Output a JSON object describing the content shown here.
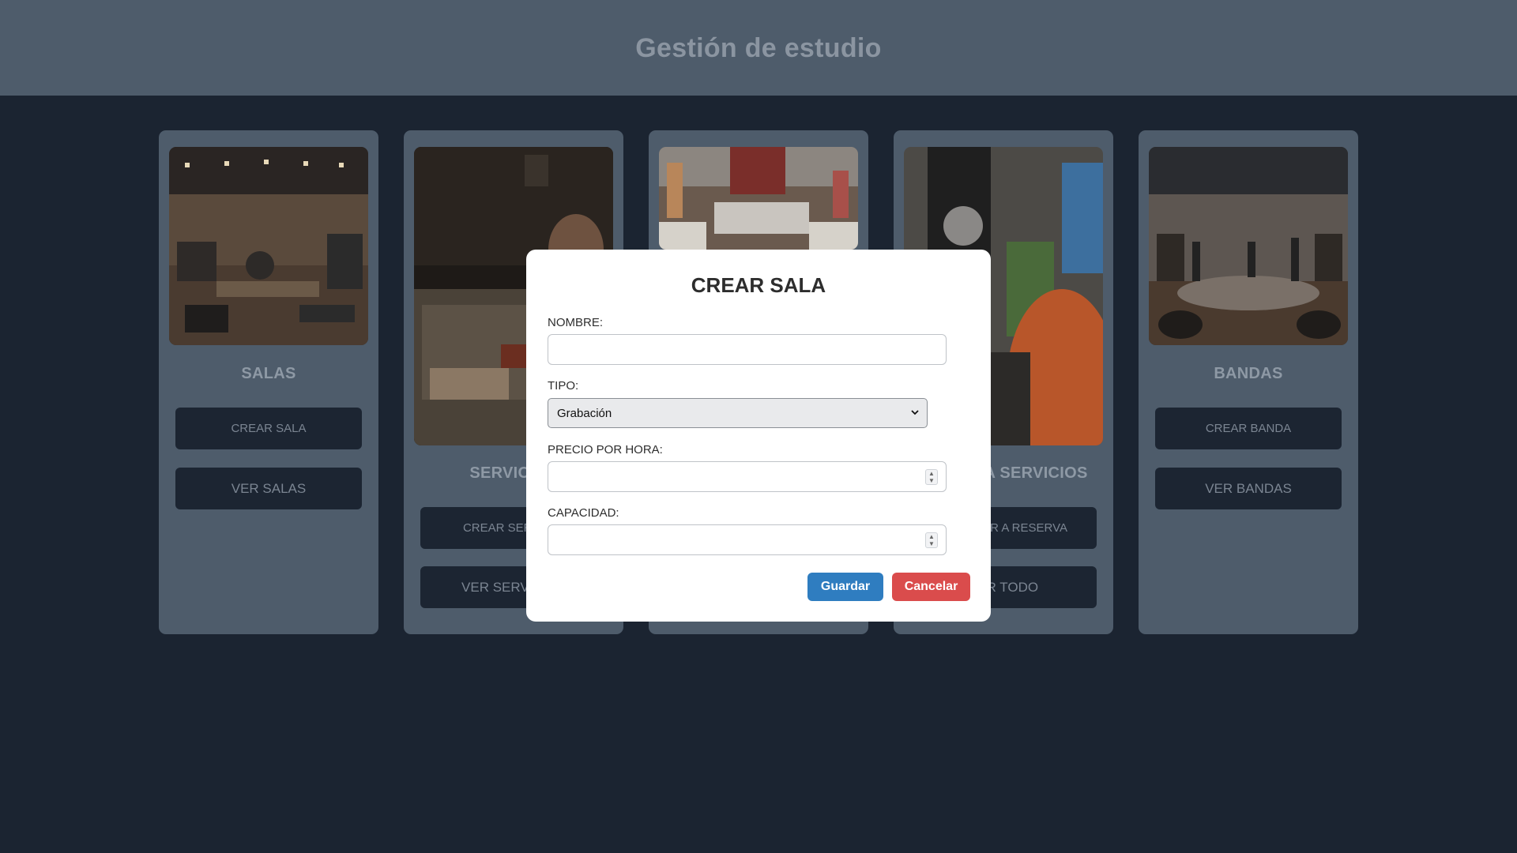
{
  "header": {
    "title": "Gestión de estudio"
  },
  "cards": [
    {
      "title": "SALAS",
      "btn1": "CREAR SALA",
      "btn2": "VER SALAS"
    },
    {
      "title": "SERVICIOS",
      "btn1": "CREAR SERVICIO",
      "btn2": "VER SERVICIOS"
    },
    {
      "title": "",
      "btn1": "",
      "btn2": ""
    },
    {
      "title": "RESERVA SERVICIOS",
      "btn1": "AGREGAR A RESERVA",
      "btn2": "VER TODO"
    },
    {
      "title": "BANDAS",
      "btn1": "CREAR BANDA",
      "btn2": "VER BANDAS"
    }
  ],
  "visible_partials": {
    "card2_title": "SERVIC",
    "card2_btn1": "CREAR SER",
    "card2_btn2": "VER SERV",
    "card4_title": "A SERVICIOS",
    "card4_btn1": "R A RESERVA",
    "card4_btn2": "R TODO"
  },
  "modal": {
    "title": "CREAR SALA",
    "nombre_label": "NOMBRE:",
    "nombre_value": "",
    "tipo_label": "TIPO:",
    "tipo_selected": "Grabación",
    "precio_label": "PRECIO POR HORA:",
    "precio_value": "",
    "capacidad_label": "CAPACIDAD:",
    "capacidad_value": "",
    "save_label": "Guardar",
    "cancel_label": "Cancelar"
  },
  "colors": {
    "page_bg": "#1b2431",
    "card_bg": "#4e5c6b",
    "button_bg": "#1c2532",
    "save_button": "#2f7dc0",
    "cancel_button": "#da4c4c"
  }
}
